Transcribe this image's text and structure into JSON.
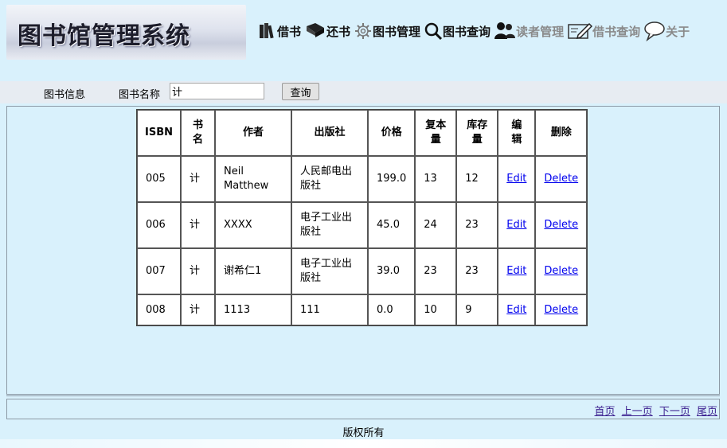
{
  "header": {
    "logo_text": "图书馆管理系统",
    "nav": [
      {
        "label": "借书",
        "icon": "books-icon",
        "muted": false
      },
      {
        "label": "还书",
        "icon": "book-return-icon",
        "muted": false
      },
      {
        "label": "图书管理",
        "icon": "gear-icon",
        "muted": false
      },
      {
        "label": "图书查询",
        "icon": "search-icon",
        "muted": false
      },
      {
        "label": "读者管理",
        "icon": "users-icon",
        "muted": true
      },
      {
        "label": "借书查询",
        "icon": "edit-icon",
        "muted": true
      },
      {
        "label": "关于",
        "icon": "speech-bubble-icon",
        "muted": true
      }
    ]
  },
  "search": {
    "section_title": "图书信息",
    "field_label": "图书名称",
    "value": "计",
    "button_label": "查询"
  },
  "table": {
    "columns": [
      "ISBN",
      "书名",
      "作者",
      "出版社",
      "价格",
      "复本量",
      "库存量",
      "编辑",
      "删除"
    ],
    "rows": [
      {
        "isbn": "005",
        "title": "计",
        "author": "Neil Matthew",
        "publisher": "人民邮电出版社",
        "price": "199.0",
        "copies": "13",
        "stock": "12",
        "edit": "Edit",
        "delete": "Delete"
      },
      {
        "isbn": "006",
        "title": "计",
        "author": "XXXX",
        "publisher": "电子工业出版社",
        "price": "45.0",
        "copies": "24",
        "stock": "23",
        "edit": "Edit",
        "delete": "Delete"
      },
      {
        "isbn": "007",
        "title": "计",
        "author": "谢希仁1",
        "publisher": "电子工业出版社",
        "price": "39.0",
        "copies": "23",
        "stock": "23",
        "edit": "Edit",
        "delete": "Delete"
      },
      {
        "isbn": "008",
        "title": "计",
        "author": "1113",
        "publisher": "111",
        "price": "0.0",
        "copies": "10",
        "stock": "9",
        "edit": "Edit",
        "delete": "Delete"
      }
    ]
  },
  "pager": {
    "first": "首页",
    "prev": "上一页",
    "next": "下一页",
    "last": "尾页"
  },
  "footer": {
    "copyright": "版权所有"
  }
}
